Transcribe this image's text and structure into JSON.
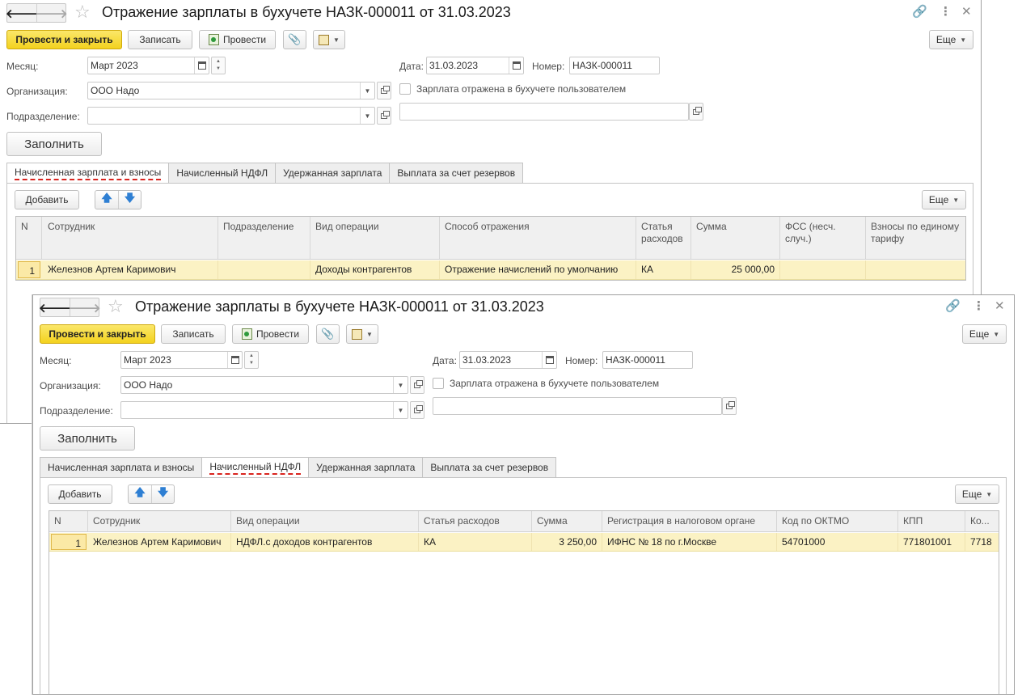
{
  "back_window": {
    "title": "Отражение зарплаты в бухучете НАЗК-000011 от 31.03.2023",
    "toolbar": {
      "post_close": "Провести и закрыть",
      "save": "Записать",
      "post": "Провести",
      "more": "Еще"
    },
    "fields": {
      "month_label": "Месяц:",
      "month_value": "Март 2023",
      "date_label": "Дата:",
      "date_value": "31.03.2023",
      "number_label": "Номер:",
      "number_value": "НАЗК-000011",
      "org_label": "Организация:",
      "org_value": "ООО Надо",
      "checkbox_label": "Зарплата отражена в бухучете пользователем",
      "dept_label": "Подразделение:",
      "dept_value": "",
      "extra_value": ""
    },
    "fill_button": "Заполнить",
    "tabs": [
      "Начисленная зарплата и взносы",
      "Начисленный НДФЛ",
      "Удержанная зарплата",
      "Выплата за счет резервов"
    ],
    "active_tab": 0,
    "add_button": "Добавить",
    "table_more": "Еще",
    "columns": [
      "N",
      "Сотрудник",
      "Подразделение",
      "Вид операции",
      "Способ отражения",
      "Статья расходов",
      "Сумма",
      "ФСС (несч. случ.)",
      "Взносы по единому тарифу"
    ],
    "rows": [
      [
        "1",
        "Железнов Артем Каримович",
        "",
        "Доходы контрагентов",
        "Отражение начислений по умолчанию",
        "КА",
        "25 000,00",
        "",
        ""
      ]
    ]
  },
  "front_window": {
    "title": "Отражение зарплаты в бухучете НАЗК-000011 от 31.03.2023",
    "toolbar": {
      "post_close": "Провести и закрыть",
      "save": "Записать",
      "post": "Провести",
      "more": "Еще"
    },
    "fields": {
      "month_label": "Месяц:",
      "month_value": "Март 2023",
      "date_label": "Дата:",
      "date_value": "31.03.2023",
      "number_label": "Номер:",
      "number_value": "НАЗК-000011",
      "org_label": "Организация:",
      "org_value": "ООО Надо",
      "checkbox_label": "Зарплата отражена в бухучете пользователем",
      "dept_label": "Подразделение:",
      "dept_value": "",
      "extra_value": ""
    },
    "fill_button": "Заполнить",
    "tabs": [
      "Начисленная зарплата и взносы",
      "Начисленный НДФЛ",
      "Удержанная зарплата",
      "Выплата за счет резервов"
    ],
    "active_tab": 1,
    "add_button": "Добавить",
    "table_more": "Еще",
    "columns": [
      "N",
      "Сотрудник",
      "Вид операции",
      "Статья расходов",
      "Сумма",
      "Регистрация в налоговом органе",
      "Код по ОКТМО",
      "КПП",
      "Ко..."
    ],
    "rows": [
      [
        "1",
        "Железнов Артем Каримович",
        "НДФЛ.с доходов контрагентов",
        "КА",
        "3 250,00",
        "ИФНС № 18 по г.Москве",
        "54701000",
        "771801001",
        "7718"
      ]
    ]
  },
  "colors": {
    "primary_button": "#f3d21e",
    "selected_row": "#fbf2c4",
    "active_tab_underline": "#d9241e",
    "move_arrows": "#2e7fd3"
  },
  "icons": [
    "back-arrow-icon",
    "forward-arrow-icon",
    "star-icon",
    "link-icon",
    "kebab-menu-icon",
    "close-icon",
    "post-document-icon",
    "paperclip-icon",
    "create-based-on-icon",
    "calendar-icon",
    "dropdown-icon",
    "open-icon",
    "move-up-icon",
    "move-down-icon"
  ]
}
